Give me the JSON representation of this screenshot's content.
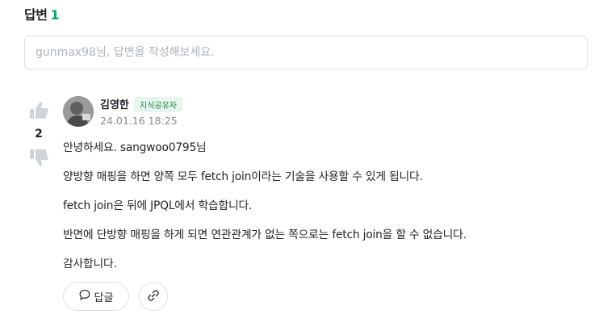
{
  "header": {
    "title": "답변",
    "count": "1"
  },
  "answer_input": {
    "placeholder": "gunmax98님, 답변을 작성해보세요.",
    "value": ""
  },
  "answer": {
    "votes": "2",
    "author": "김영한",
    "badge": "지식공유자",
    "date": "24.01.16 18:25",
    "paragraphs": [
      "안녕하세요. sangwoo0795님",
      "양방향 매핑을 하면 양쪽 모두 fetch join이라는 기술을 사용할 수 있게 됩니다.",
      "fetch join은 뒤에 JPQL에서 학습합니다.",
      "반면에 단방향 매핑을 하게 되면 연관관계가 없는 쪽으로는 fetch join을 할 수 없습니다.",
      "감사합니다."
    ],
    "reply_label": "답글"
  },
  "icons": {
    "upvote": "thumbs-up-icon",
    "downvote": "thumbs-down-icon",
    "reply": "speech-bubble-icon",
    "link": "link-icon"
  },
  "colors": {
    "accent": "#00a86b",
    "badge_bg": "#e6f6ec",
    "vote_icon": "#ced4da"
  }
}
